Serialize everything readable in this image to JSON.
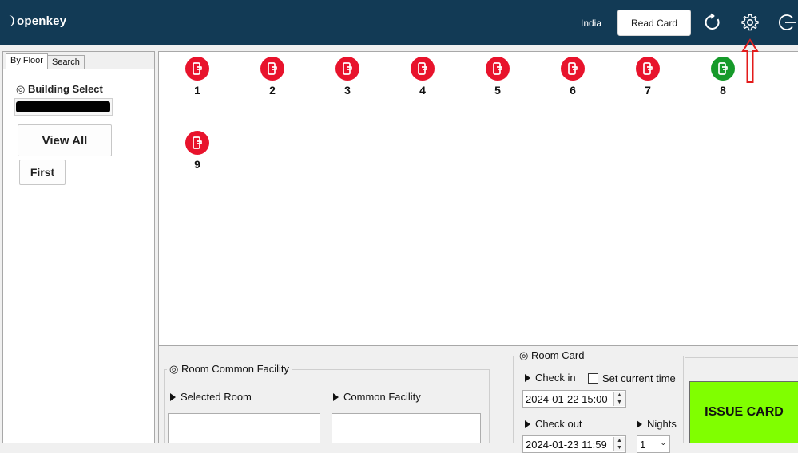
{
  "header": {
    "logo": "openkey",
    "country": "India",
    "read_card_label": "Read Card",
    "icons": [
      "refresh-icon",
      "gear-icon",
      "logout-icon"
    ]
  },
  "left_panel": {
    "tabs": [
      "By Floor",
      "Search"
    ],
    "building_select_label": "◎ Building Select",
    "view_all_label": "View All",
    "first_label": "First"
  },
  "rooms": [
    {
      "number": "1",
      "status": "red"
    },
    {
      "number": "2",
      "status": "red"
    },
    {
      "number": "3",
      "status": "red"
    },
    {
      "number": "4",
      "status": "red"
    },
    {
      "number": "5",
      "status": "red"
    },
    {
      "number": "6",
      "status": "red"
    },
    {
      "number": "7",
      "status": "red"
    },
    {
      "number": "8",
      "status": "green"
    },
    {
      "number": "9",
      "status": "red"
    }
  ],
  "room_common_facility": {
    "title": "◎ Room  Common Facility",
    "selected_room_label": "Selected Room",
    "common_facility_label": "Common Facility"
  },
  "room_card": {
    "title": "◎ Room Card",
    "check_in_label": "Check in",
    "set_current_time_label": "Set current time",
    "check_in_value": "2024-01-22 15:00",
    "check_out_label": "Check out",
    "check_out_value": "2024-01-23 11:59",
    "nights_label": "Nights",
    "nights_value": "1"
  },
  "issue_card_label": "ISSUE CARD",
  "colors": {
    "header_bg": "#123a55",
    "room_red": "#e8132c",
    "room_green": "#169a2a",
    "issue_green": "#80ff00",
    "annotation_red": "#e31b1b"
  }
}
